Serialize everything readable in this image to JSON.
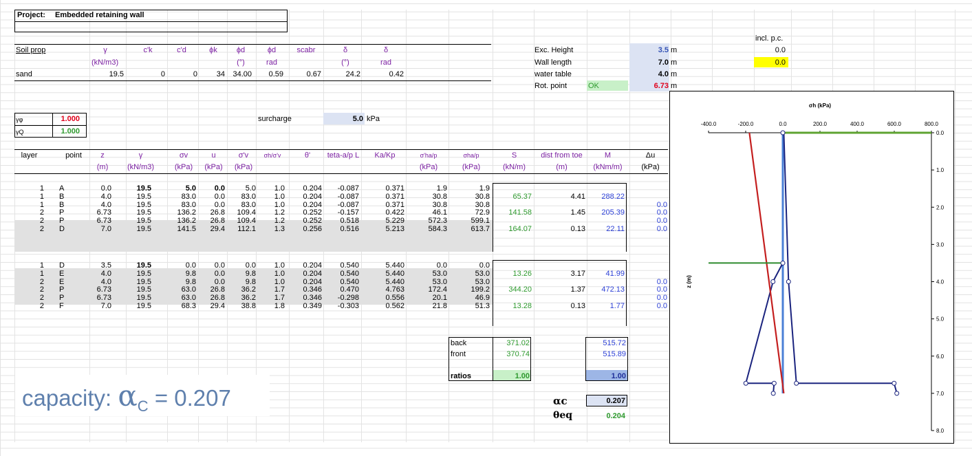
{
  "project": {
    "label": "Project:",
    "title": "Embedded retaining wall"
  },
  "soil": {
    "headers": [
      "Soil prop",
      "γ",
      "c'k",
      "c'd",
      "ϕk",
      "ϕd",
      "ϕd",
      "scabr",
      "δ",
      "δ"
    ],
    "units": [
      "(kN/m3)",
      "(°)",
      "rad",
      "(°)",
      "rad"
    ],
    "row": {
      "name": "sand",
      "gamma": "19.5",
      "ck": "0",
      "cd": "0",
      "phik": "34",
      "phid": "34.00",
      "phid_rad": "0.59",
      "scabr": "0.67",
      "delta": "24.2",
      "delta_rad": "0.42"
    }
  },
  "factors": {
    "gphi_label": "γφ",
    "gphi": "1.000",
    "gq_label": "γQ",
    "gq": "1.000"
  },
  "surcharge": {
    "label": "surcharge",
    "value": "5.0",
    "unit": "kPa"
  },
  "geometry": {
    "incl_label": "incl. p.c.",
    "exc_label": "Exc. Height",
    "exc": "3.5",
    "exc_unit": "m",
    "incl_top": "0.0",
    "wall_label": "Wall length",
    "wall": "7.0",
    "wall_unit": "m",
    "incl_yellow": "0.0",
    "wt_label": "water table",
    "wt": "4.0",
    "wt_unit": "m",
    "rot_label": "Rot. point",
    "rot_ok": "OK",
    "rot": "6.73",
    "rot_unit": "m"
  },
  "table": {
    "headers": [
      "layer",
      "point",
      "z",
      "γ",
      "σv",
      "u",
      "σ'v",
      "σh/σ'v",
      "θ'",
      "teta-a/p L",
      "Ka/Kp",
      "σ'ha/p",
      "σha/p",
      "S",
      "dist from toe",
      "M",
      "Δu"
    ],
    "units": [
      "(m)",
      "(kN/m3)",
      "(kPa)",
      "(kPa)",
      "(kPa)",
      "(kPa)",
      "(kPa)",
      "(kN/m)",
      "(m)",
      "(kNm/m)",
      "(kPa)"
    ],
    "back": [
      [
        "1",
        "A",
        "0.0",
        "19.5",
        "5.0",
        "0.0",
        "5.0",
        "1.0",
        "0.204",
        "-0.087",
        "0.371",
        "1.9",
        "1.9",
        "",
        "",
        "",
        ""
      ],
      [
        "1",
        "B",
        "4.0",
        "19.5",
        "83.0",
        "0.0",
        "83.0",
        "1.0",
        "0.204",
        "-0.087",
        "0.371",
        "30.8",
        "30.8",
        "65.37",
        "4.41",
        "288.22",
        ""
      ],
      [
        "1",
        "B",
        "4.0",
        "19.5",
        "83.0",
        "0.0",
        "83.0",
        "1.0",
        "0.204",
        "-0.087",
        "0.371",
        "30.8",
        "30.8",
        "",
        "",
        "",
        "0.0"
      ],
      [
        "2",
        "P",
        "6.73",
        "19.5",
        "136.2",
        "26.8",
        "109.4",
        "1.2",
        "0.252",
        "-0.157",
        "0.422",
        "46.1",
        "72.9",
        "141.58",
        "1.45",
        "205.39",
        "0.0"
      ],
      [
        "2",
        "P",
        "6.73",
        "19.5",
        "136.2",
        "26.8",
        "109.4",
        "1.2",
        "0.252",
        "0.518",
        "5.229",
        "572.3",
        "599.1",
        "",
        "",
        "",
        "0.0"
      ],
      [
        "2",
        "D",
        "7.0",
        "19.5",
        "141.5",
        "29.4",
        "112.1",
        "1.3",
        "0.256",
        "0.516",
        "5.213",
        "584.3",
        "613.7",
        "164.07",
        "0.13",
        "22.11",
        "0.0"
      ]
    ],
    "front": [
      [
        "1",
        "D",
        "3.5",
        "19.5",
        "0.0",
        "0.0",
        "0.0",
        "1.0",
        "0.204",
        "0.540",
        "5.440",
        "0.0",
        "0.0",
        "",
        "",
        "",
        ""
      ],
      [
        "1",
        "E",
        "4.0",
        "19.5",
        "9.8",
        "0.0",
        "9.8",
        "1.0",
        "0.204",
        "0.540",
        "5.440",
        "53.0",
        "53.0",
        "13.26",
        "3.17",
        "41.99",
        ""
      ],
      [
        "2",
        "E",
        "4.0",
        "19.5",
        "9.8",
        "0.0",
        "9.8",
        "1.0",
        "0.204",
        "0.540",
        "5.440",
        "53.0",
        "53.0",
        "",
        "",
        "",
        "0.0"
      ],
      [
        "2",
        "P",
        "6.73",
        "19.5",
        "63.0",
        "26.8",
        "36.2",
        "1.7",
        "0.346",
        "0.470",
        "4.763",
        "172.4",
        "199.2",
        "344.20",
        "1.37",
        "472.13",
        "0.0"
      ],
      [
        "2",
        "P",
        "6.73",
        "19.5",
        "63.0",
        "26.8",
        "36.2",
        "1.7",
        "0.346",
        "-0.298",
        "0.556",
        "20.1",
        "46.9",
        "",
        "",
        "",
        "0.0"
      ],
      [
        "2",
        "F",
        "7.0",
        "19.5",
        "68.3",
        "29.4",
        "38.8",
        "1.8",
        "0.349",
        "-0.303",
        "0.562",
        "21.8",
        "51.3",
        "13.28",
        "0.13",
        "1.77",
        "0.0"
      ]
    ]
  },
  "summary": {
    "back_label": "back",
    "back_S": "371.02",
    "back_M": "515.72",
    "front_label": "front",
    "front_S": "370.74",
    "front_M": "515.89",
    "ratios_label": "ratios",
    "ratio_S": "1.00",
    "ratio_M": "1.00",
    "ac_label": "αc",
    "ac": "0.207",
    "teq_label": "θeq",
    "teq": "0.204"
  },
  "capacity": {
    "prefix": "capacity: ",
    "alpha": "α",
    "sub": "C",
    "suffix": " = 0.207"
  },
  "colors": {
    "input": "#dce3f3",
    "ok": "#c8f0c8",
    "yellow": "#ffff00",
    "red": "#e0001a",
    "green": "#2e9a2e",
    "blue": "#2b3fd6",
    "purple": "#7b1fa2"
  },
  "chart_data": {
    "type": "line",
    "title": "σh (kPa)",
    "xlabel": "",
    "ylabel": "z (m)",
    "xlim": [
      -400,
      800
    ],
    "ylim": [
      0,
      8
    ],
    "y_inverted": true,
    "x_ticks": [
      "-400.0",
      "-200.0",
      "0.0",
      "200.0",
      "400.0",
      "600.0",
      "800.0"
    ],
    "y_ticks": [
      "0.0",
      "1.0",
      "2.0",
      "3.0",
      "4.0",
      "5.0",
      "6.0",
      "7.0",
      "8.0"
    ],
    "series": [
      {
        "role": "wall",
        "color": "#4a7fd6",
        "points": [
          [
            0,
            0
          ],
          [
            0,
            7
          ]
        ]
      },
      {
        "role": "back-pressure",
        "color": "#1a237e",
        "points": [
          [
            5,
            0
          ],
          [
            30.8,
            4
          ],
          [
            72.9,
            6.73
          ],
          [
            599.1,
            6.73
          ],
          [
            613.7,
            7
          ]
        ]
      },
      {
        "role": "front-pressure",
        "color": "#1a237e",
        "points": [
          [
            0,
            3.5
          ],
          [
            -53,
            4
          ],
          [
            -199.2,
            6.73
          ],
          [
            -46.9,
            6.73
          ],
          [
            -51.3,
            7
          ]
        ]
      },
      {
        "role": "net-line",
        "color": "#c41f1f",
        "points": [
          [
            -180,
            0
          ],
          [
            5,
            7
          ]
        ]
      },
      {
        "role": "ground-back",
        "color": "#5ea331",
        "points": [
          [
            0,
            0
          ],
          [
            800,
            0
          ]
        ]
      },
      {
        "role": "ground-front",
        "color": "#2e8b2e",
        "points": [
          [
            -400,
            3.5
          ],
          [
            0,
            3.5
          ]
        ]
      }
    ],
    "markers": [
      [
        0,
        0
      ],
      [
        0,
        3.5
      ],
      [
        -53,
        4
      ],
      [
        30.8,
        4
      ],
      [
        -199.2,
        6.73
      ],
      [
        -46.9,
        6.73
      ],
      [
        72.9,
        6.73
      ],
      [
        599.1,
        6.73
      ],
      [
        -51.3,
        7
      ],
      [
        613.7,
        7
      ]
    ]
  }
}
